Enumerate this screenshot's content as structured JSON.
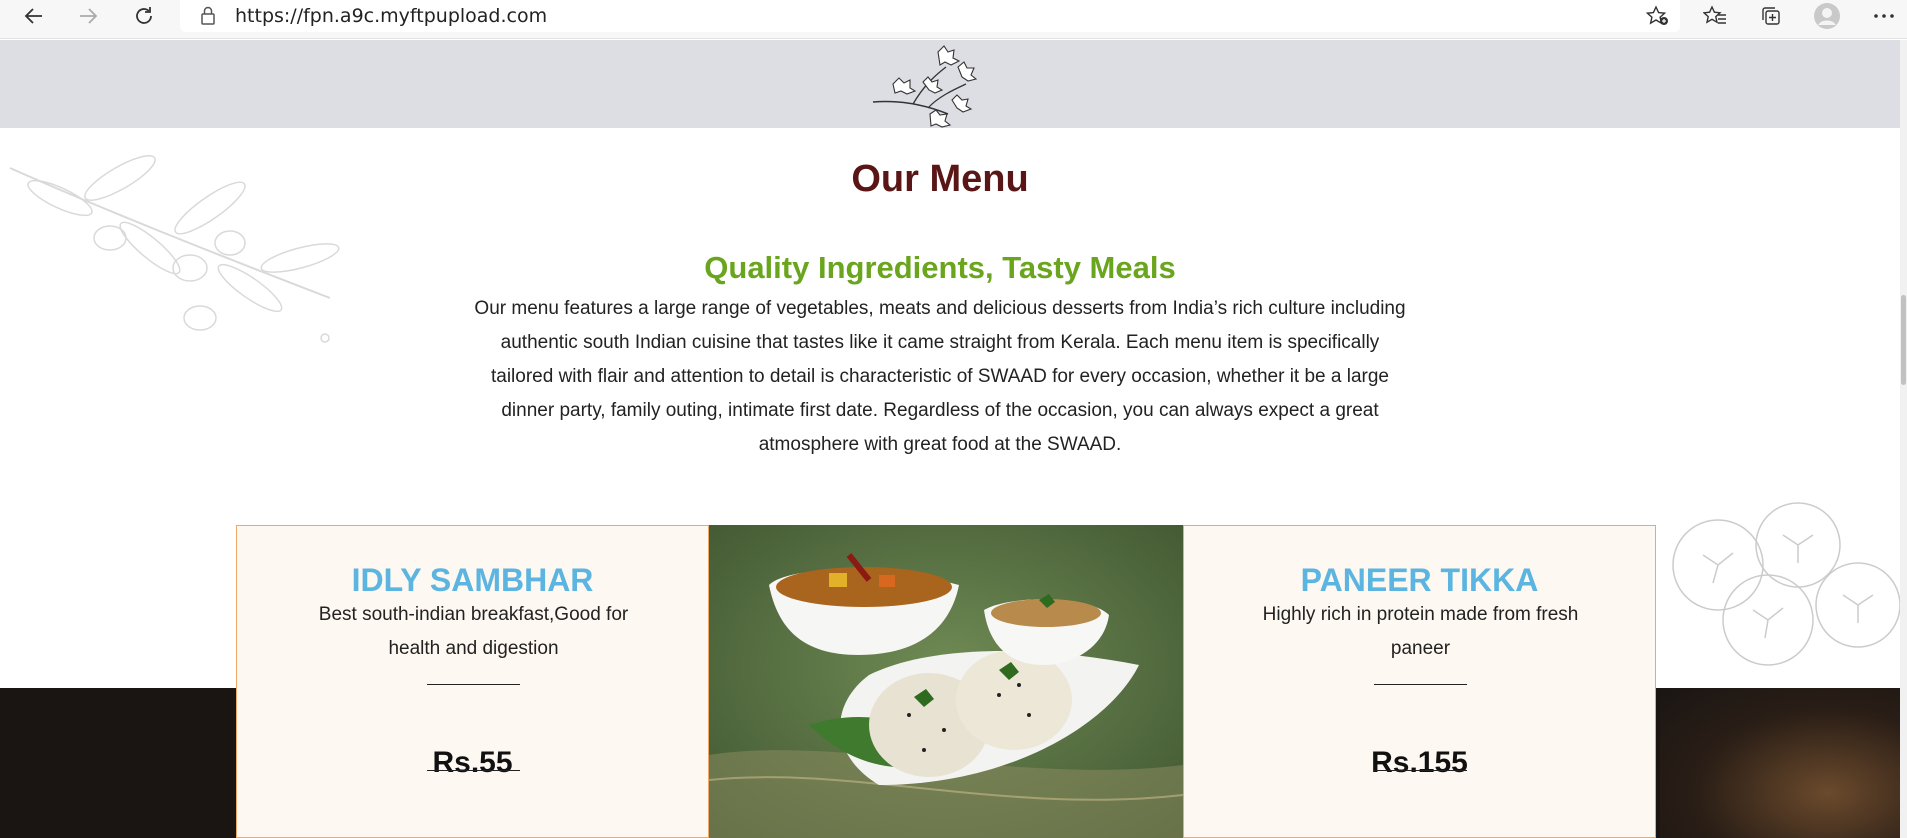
{
  "browser": {
    "url": "https://fpn.a9c.myftpupload.com",
    "icons": [
      "back-icon",
      "forward-icon",
      "refresh-icon",
      "lock-icon",
      "add-favorite-icon",
      "favorites-icon",
      "collections-icon",
      "profile-icon",
      "more-icon"
    ]
  },
  "menu": {
    "title": "Our Menu",
    "subtitle": "Quality Ingredients, Tasty Meals",
    "description": "Our menu features a large range of vegetables, meats and delicious desserts from India’s rich culture including authentic south Indian cuisine that tastes like it came straight from Kerala. Each menu item is specifically tailored with flair and attention to detail is characteristic of SWAAD for every occasion, whether it be a large dinner party, family outing, intimate first date. Regardless of the occasion, you can always expect a great atmosphere with great food at the SWAAD.",
    "items": [
      {
        "name": "IDLY SAMBHAR",
        "description": "Best south-indian breakfast,Good for health and digestion",
        "price": "Rs.55"
      },
      {
        "name": "PANEER TIKKA",
        "description": "Highly rich in protein made from fresh paneer",
        "price": "Rs.155"
      }
    ]
  },
  "colors": {
    "title": "#5a1616",
    "subtitle": "#6aa51e",
    "dish_name": "#5bb5e0",
    "card_border": "#f0a868",
    "card_bg": "#fdf8f1",
    "banner": "#dddde4"
  }
}
